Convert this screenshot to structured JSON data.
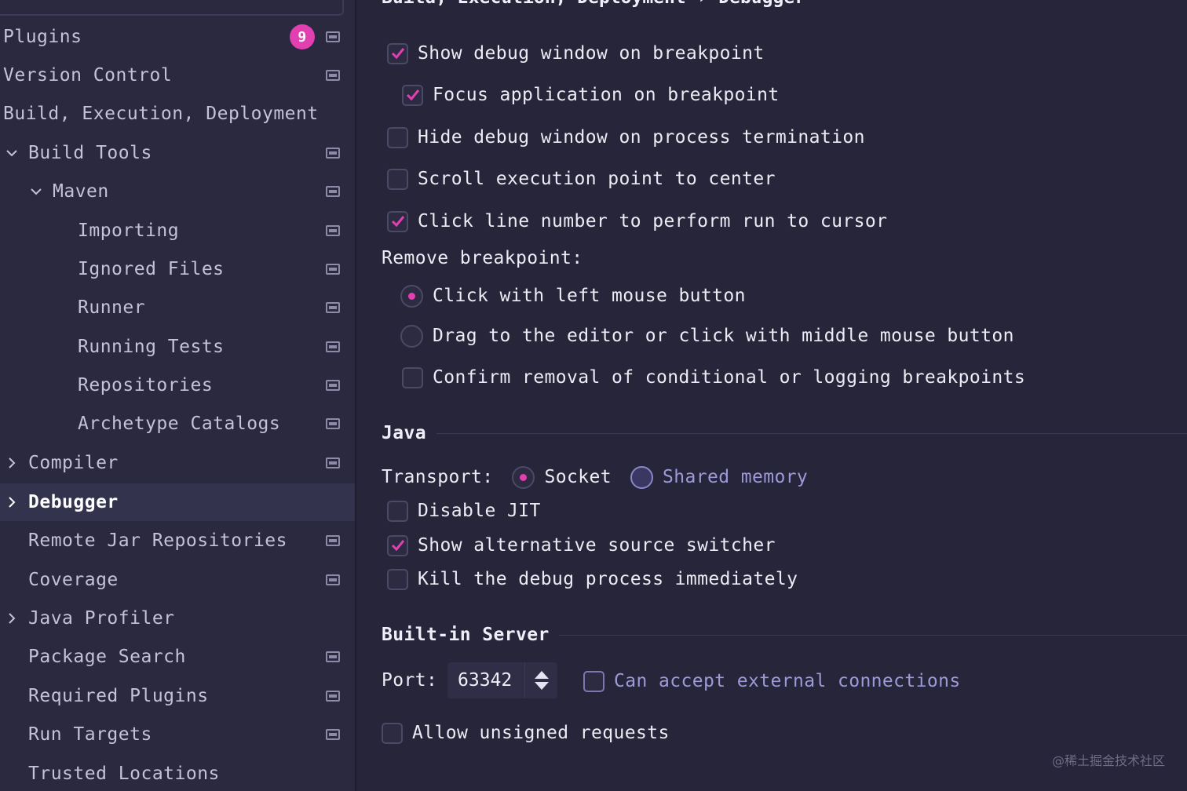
{
  "sidebar": {
    "plugins_badge": "9",
    "items": [
      {
        "label": "Plugins"
      },
      {
        "label": "Version Control"
      },
      {
        "label": "Build, Execution, Deployment"
      },
      {
        "label": "Build Tools"
      },
      {
        "label": "Maven"
      },
      {
        "label": "Importing"
      },
      {
        "label": "Ignored Files"
      },
      {
        "label": "Runner"
      },
      {
        "label": "Running Tests"
      },
      {
        "label": "Repositories"
      },
      {
        "label": "Archetype Catalogs"
      },
      {
        "label": "Compiler"
      },
      {
        "label": "Debugger"
      },
      {
        "label": "Remote Jar Repositories"
      },
      {
        "label": "Coverage"
      },
      {
        "label": "Java Profiler"
      },
      {
        "label": "Package Search"
      },
      {
        "label": "Required Plugins"
      },
      {
        "label": "Run Targets"
      },
      {
        "label": "Trusted Locations"
      }
    ]
  },
  "breadcrumb": "Build, Execution, Deployment  › Debugger",
  "general": {
    "show_debug_window": "Show debug window on breakpoint",
    "focus_application": "Focus application on breakpoint",
    "hide_debug_window": "Hide debug window on process termination",
    "scroll_execution": "Scroll execution point to center",
    "click_line_number": "Click line number to perform run to cursor"
  },
  "remove_breakpoint": {
    "title": "Remove breakpoint:",
    "click_left": "Click with left mouse button",
    "drag_editor": "Drag to the editor or click with middle mouse button",
    "confirm_removal": "Confirm removal of conditional or logging breakpoints"
  },
  "java": {
    "title": "Java",
    "transport_label": "Transport:",
    "socket": "Socket",
    "shared_memory": "Shared memory",
    "disable_jit": "Disable JIT",
    "show_alt_source": "Show alternative source switcher",
    "kill_process": "Kill the debug process immediately"
  },
  "server": {
    "title": "Built-in Server",
    "port_label": "Port:",
    "port_value": "63342",
    "accept_external": "Can accept external connections",
    "allow_unsigned": "Allow unsigned requests"
  },
  "watermark": "@稀土掘金技术社区",
  "colors": {
    "accent": "#e23fb1",
    "background": "#26253a",
    "sidebar": "#2a2940",
    "selected": "#34334d"
  }
}
